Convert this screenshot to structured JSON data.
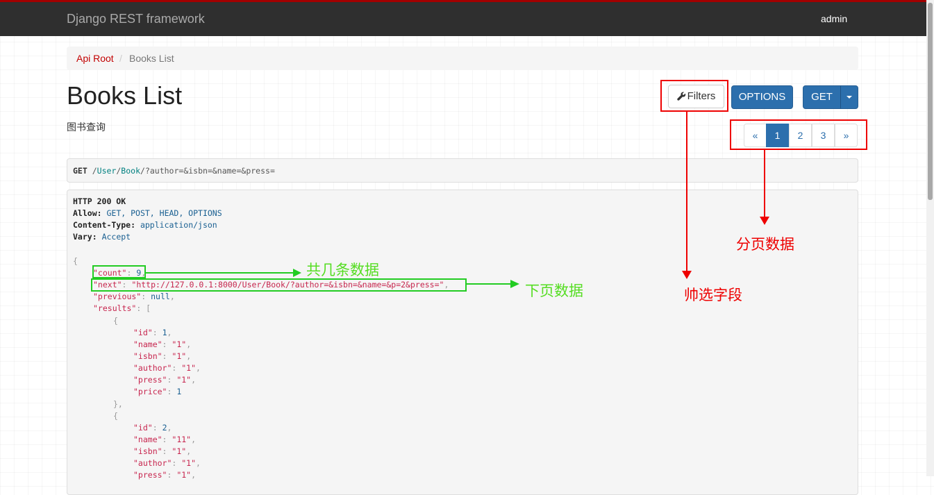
{
  "navbar": {
    "brand": "Django REST framework",
    "user": "admin"
  },
  "breadcrumb": {
    "root": "Api Root",
    "separator": "/",
    "current": "Books List"
  },
  "page": {
    "title": "Books List",
    "description": "图书查询"
  },
  "buttons": {
    "filters": "Filters",
    "options": "OPTIONS",
    "get": "GET"
  },
  "pagination": {
    "prev": "«",
    "pages": [
      "1",
      "2",
      "3"
    ],
    "next": "»",
    "active_page": "1"
  },
  "request": {
    "method": "GET",
    "path_parts": [
      "/",
      "User",
      "/",
      "Book",
      "/"
    ],
    "query": "?author=&isbn=&name=&press="
  },
  "response": {
    "status": "HTTP 200 OK",
    "headers": [
      {
        "name": "Allow:",
        "value": "GET, POST, HEAD, OPTIONS"
      },
      {
        "name": "Content-Type:",
        "value": "application/json"
      },
      {
        "name": "Vary:",
        "value": "Accept"
      }
    ],
    "open_brace": "{",
    "count_key": "\"count\"",
    "count_value": "9",
    "next_key": "\"next\"",
    "next_value": "\"http://127.0.0.1:8000/User/Book/?author=&isbn=&name=&p=2&press=\"",
    "previous_key": "\"previous\"",
    "previous_value": "null",
    "results_key": "\"results\"",
    "results_open": "[",
    "results": [
      {
        "id": "1",
        "name": "\"1\"",
        "isbn": "\"1\"",
        "author": "\"1\"",
        "press": "\"1\"",
        "price": "1"
      },
      {
        "id": "2",
        "name": "\"11\"",
        "isbn": "\"1\"",
        "author": "\"1\"",
        "press": "\"1\""
      }
    ]
  },
  "annotations": {
    "filters_label": "帅选字段",
    "pagination_label": "分页数据",
    "count_label": "共几条数据",
    "next_label": "下页数据"
  },
  "colors": {
    "annotation_red": "#ee0000",
    "annotation_green": "#22cc22",
    "primary": "#2c6fad",
    "nav_bg": "#2f2f2f"
  }
}
